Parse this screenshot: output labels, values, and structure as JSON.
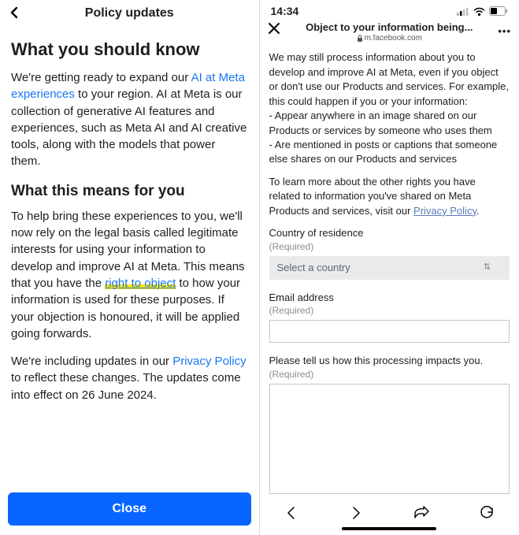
{
  "left": {
    "header_title": "Policy updates",
    "h1": "What you should know",
    "p1_a": "We're getting ready to expand our ",
    "p1_link": "AI at Meta experiences",
    "p1_b": " to your region. AI at Meta is our collection of generative AI features and experiences, such as Meta AI and AI creative tools, along with the models that power them.",
    "h2": "What this means for you",
    "p2_a": "To help bring these experiences to you, we'll now rely on the legal basis called legitimate interests for using your information to develop and improve AI at Meta. This means that you have the ",
    "p2_highlight": "right to object",
    "p2_b": " to how your information is used for these purposes. If your objection is honoured, it will be applied going forwards.",
    "p3_a": "We're including updates in our ",
    "p3_link": "Privacy Policy",
    "p3_b": " to reflect these changes. The updates come into effect on 26 June 2024.",
    "close": "Close"
  },
  "right": {
    "status_time": "14:34",
    "title": "Object to your information being...",
    "domain": "m.facebook.com",
    "para1": "We may still process information about you to develop and improve AI at Meta, even if you object or don't use our Products and services. For example, this could happen if you or your information:",
    "bullet1": "- Appear anywhere in an image shared on our Products or services by someone who uses them",
    "bullet2": "- Are mentioned in posts or captions that someone else shares on our Products and services",
    "para2_a": "To learn more about the other rights you have related to information you've shared on Meta Products and services, visit our ",
    "para2_link": "Privacy Policy",
    "para2_b": ".",
    "country_label": "Country of residence",
    "required": "(Required)",
    "select_placeholder": "Select a country",
    "email_label": "Email address",
    "impact_label": "Please tell us how this processing impacts you."
  }
}
